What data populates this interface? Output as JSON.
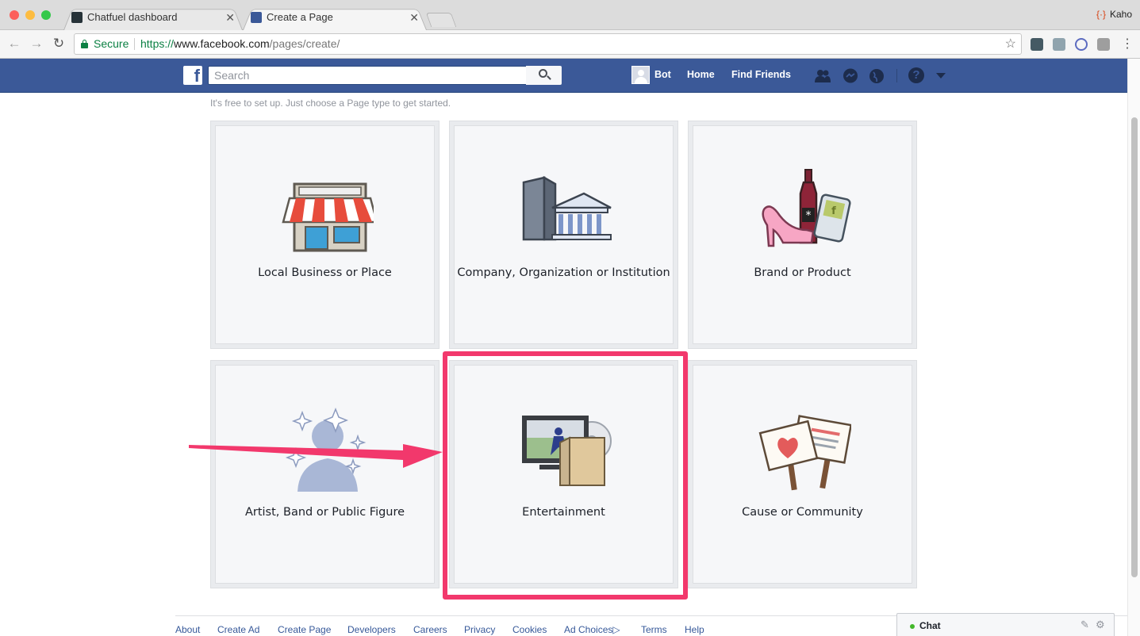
{
  "browser": {
    "tabs": [
      {
        "label": "Chatfuel dashboard",
        "favicon": "chatfuel-icon"
      },
      {
        "label": "Create a Page",
        "favicon": "facebook-icon"
      }
    ],
    "profile_name": "Kaho",
    "secure_label": "Secure",
    "url_scheme": "https://",
    "url_host": "www.facebook.com",
    "url_path": "/pages/create/"
  },
  "fb": {
    "search_placeholder": "Search",
    "user_name": "Bot",
    "nav_home": "Home",
    "nav_find_friends": "Find Friends",
    "brand_color": "#3b5998"
  },
  "page": {
    "intro": "It's free to set up. Just choose a Page type to get started.",
    "categories": [
      {
        "label": "Local Business or Place"
      },
      {
        "label": "Company, Organization or Institution"
      },
      {
        "label": "Brand or Product"
      },
      {
        "label": "Artist, Band or Public Figure"
      },
      {
        "label": "Entertainment"
      },
      {
        "label": "Cause or Community"
      }
    ],
    "highlight_color": "#f2386c"
  },
  "footer": {
    "links": [
      "About",
      "Create Ad",
      "Create Page",
      "Developers",
      "Careers",
      "Privacy",
      "Cookies",
      "Ad Choices",
      "Terms",
      "Help"
    ]
  },
  "chat": {
    "label": "Chat"
  }
}
